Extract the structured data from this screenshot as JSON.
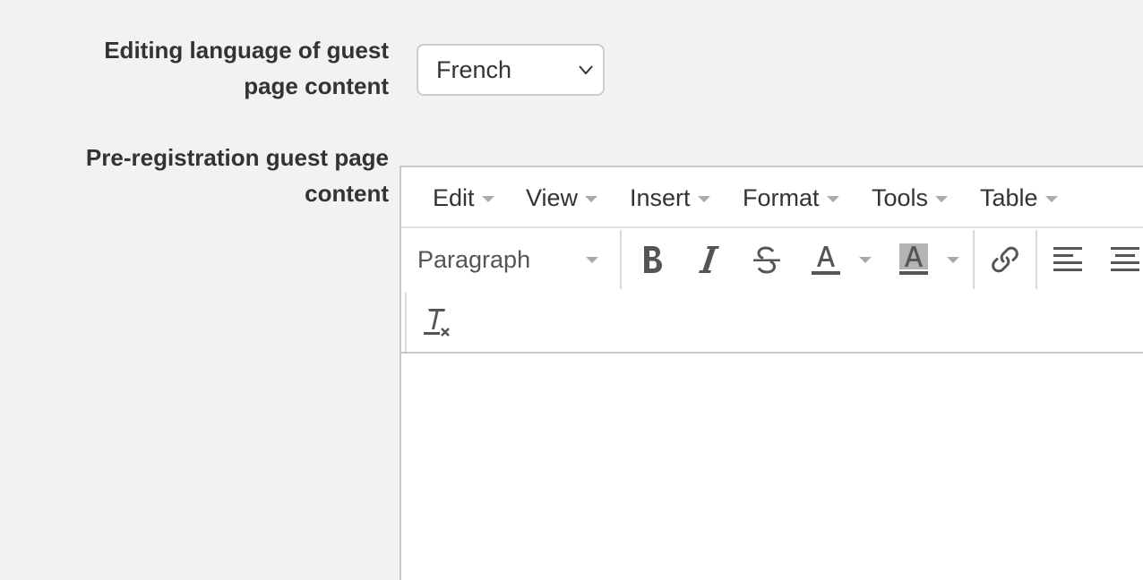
{
  "form": {
    "language_label_line1": "Editing language of guest",
    "language_label_line2": "page content",
    "language_value": "French",
    "content_label_line1": "Pre-registration guest page",
    "content_label_line2": "content"
  },
  "editor": {
    "menu": [
      "Edit",
      "View",
      "Insert",
      "Format",
      "Tools",
      "Table"
    ],
    "block_format": "Paragraph",
    "text_content": ""
  },
  "icons": {
    "bold": "bold-icon",
    "italic": "italic-icon",
    "strikethrough": "strikethrough-icon",
    "text_color": "text-color-icon",
    "background_color": "background-color-icon",
    "link": "link-icon",
    "align_left": "align-left-icon",
    "align_center": "align-center-icon",
    "clear_formatting": "clear-formatting-icon"
  },
  "colors": {
    "page_background": "#f2f2f2",
    "text": "#333333",
    "icon": "#555555",
    "highlight_swatch": "#b3b3b3"
  }
}
